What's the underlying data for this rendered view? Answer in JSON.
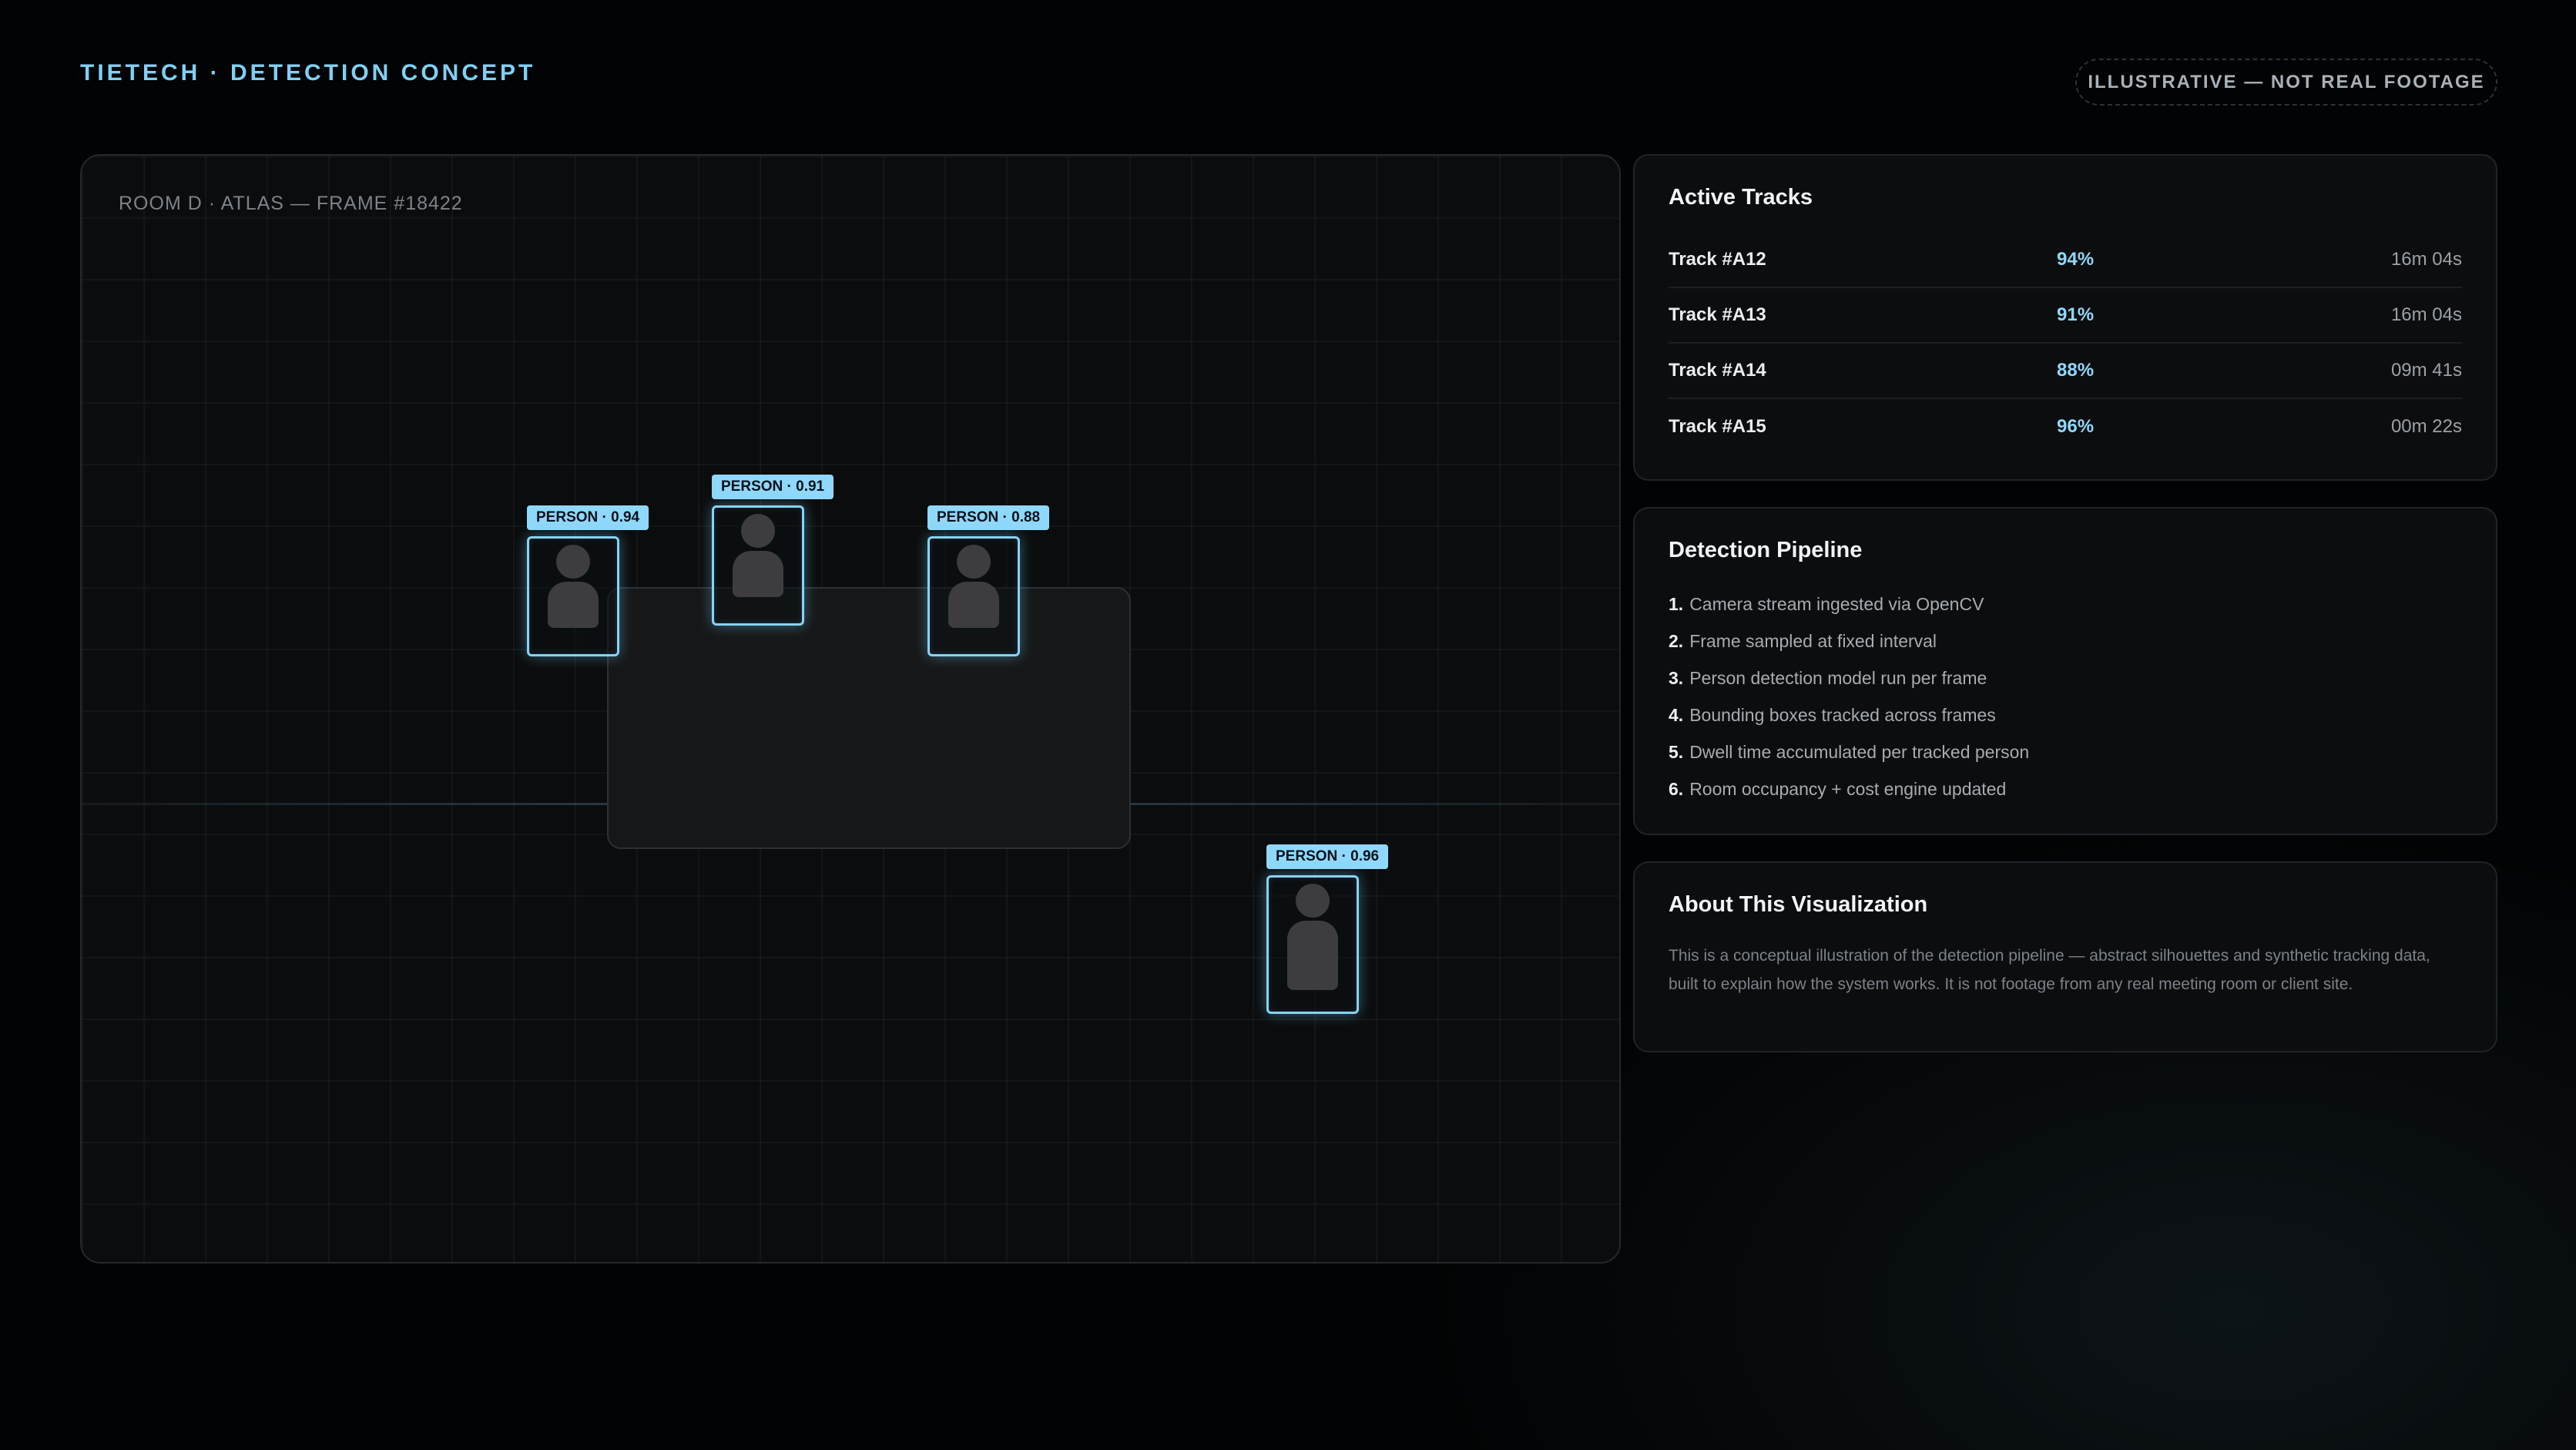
{
  "header": {
    "brand": "TIETECH · DETECTION CONCEPT",
    "disclaimer": "ILLUSTRATIVE — NOT REAL FOOTAGE"
  },
  "scene": {
    "label": "ROOM D · ATLAS — FRAME #18422",
    "detections": [
      {
        "label": "PERSON · 0.94"
      },
      {
        "label": "PERSON · 0.91"
      },
      {
        "label": "PERSON · 0.88"
      },
      {
        "label": "PERSON · 0.96"
      }
    ]
  },
  "tracks_panel": {
    "title": "Active Tracks",
    "rows": [
      {
        "id": "Track #A12",
        "confidence": "94%",
        "duration": "16m 04s"
      },
      {
        "id": "Track #A13",
        "confidence": "91%",
        "duration": "16m 04s"
      },
      {
        "id": "Track #A14",
        "confidence": "88%",
        "duration": "09m 41s"
      },
      {
        "id": "Track #A15",
        "confidence": "96%",
        "duration": "00m 22s"
      }
    ]
  },
  "pipeline_panel": {
    "title": "Detection Pipeline",
    "steps": [
      {
        "num": "1.",
        "text": "Camera stream ingested via OpenCV"
      },
      {
        "num": "2.",
        "text": "Frame sampled at fixed interval"
      },
      {
        "num": "3.",
        "text": "Person detection model run per frame"
      },
      {
        "num": "4.",
        "text": "Bounding boxes tracked across frames"
      },
      {
        "num": "5.",
        "text": "Dwell time accumulated per tracked person"
      },
      {
        "num": "6.",
        "text": "Room occupancy + cost engine updated"
      }
    ]
  },
  "about_panel": {
    "title": "About This Visualization",
    "text": "This is a conceptual illustration of the detection pipeline — abstract silhouettes and synthetic tracking data, built to explain how the system works. It is not footage from any real meeting room or client site."
  },
  "colors": {
    "accent": "#8fd8fb",
    "brand": "#7fd0f5",
    "background": "#020304"
  }
}
